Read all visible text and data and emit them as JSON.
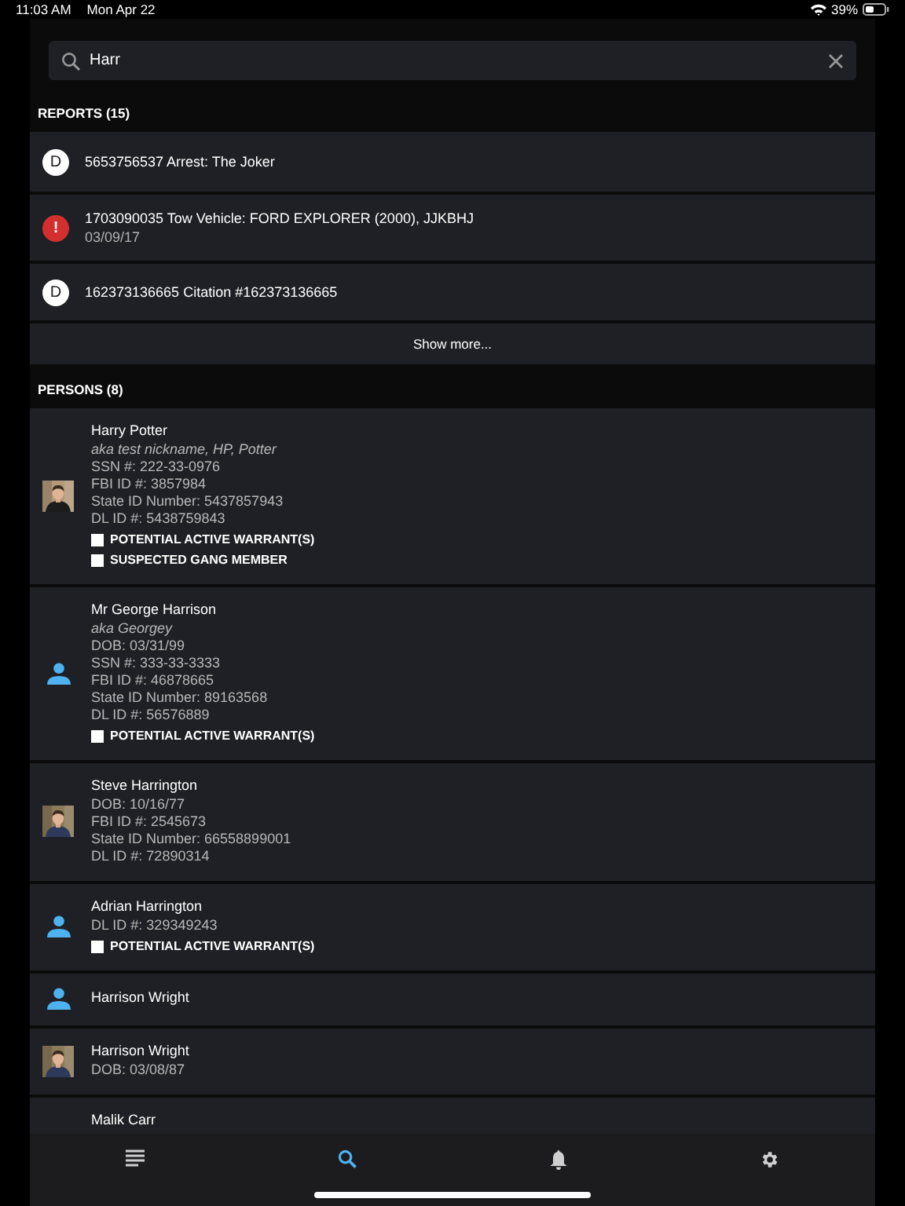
{
  "status_bar": {
    "time": "11:03 AM",
    "date": "Mon Apr 22",
    "battery": "39%"
  },
  "search": {
    "value": "Harr"
  },
  "reports": {
    "title": "REPORTS (15)",
    "items": [
      {
        "badge": {
          "kind": "letter",
          "text": "D"
        },
        "title": "5653756537 Arrest: The Joker"
      },
      {
        "badge": {
          "kind": "alert",
          "text": "!"
        },
        "title": "1703090035 Tow Vehicle: FORD EXPLORER (2000), JJKBHJ",
        "subtitle": "03/09/17"
      },
      {
        "badge": {
          "kind": "letter",
          "text": "D"
        },
        "title": "162373136665 Citation #162373136665"
      }
    ],
    "show_more": "Show more..."
  },
  "persons": {
    "title": "PERSONS (8)",
    "items": [
      {
        "kind": "picture",
        "name": "Harry Potter",
        "aka": "aka test nickname, HP, Potter",
        "details": [
          "SSN #: 222-33-0976",
          "FBI ID #: 3857984",
          "State ID Number: 5437857943",
          "DL ID #: 5438759843"
        ],
        "flags": [
          "POTENTIAL ACTIVE WARRANT(S)",
          "SUSPECTED GANG MEMBER"
        ]
      },
      {
        "kind": "icon",
        "name": "Mr George Harrison",
        "aka": "aka Georgey",
        "details": [
          "DOB: 03/31/99",
          "SSN #: 333-33-3333",
          "FBI ID #: 46878665",
          "State ID Number: 89163568",
          "DL ID #: 56576889"
        ],
        "flags": [
          "POTENTIAL ACTIVE WARRANT(S)"
        ]
      },
      {
        "kind": "picture",
        "name": "Steve Harrington",
        "details": [
          "DOB: 10/16/77",
          "FBI ID #: 2545673",
          "State ID Number: 66558899001",
          "DL ID #: 72890314"
        ]
      },
      {
        "kind": "icon",
        "name": "Adrian Harrington",
        "details": [
          "DL ID #: 329349243"
        ],
        "flags": [
          "POTENTIAL ACTIVE WARRANT(S)"
        ]
      },
      {
        "kind": "icon",
        "name": "Harrison Wright"
      },
      {
        "kind": "picture",
        "name": "Harrison Wright",
        "details": [
          "DOB: 03/08/87"
        ]
      },
      {
        "name": "Malik Carr"
      }
    ]
  },
  "tabs": [
    {
      "kind": "list",
      "selected": false
    },
    {
      "kind": "search",
      "selected": true
    },
    {
      "kind": "bell",
      "selected": false
    },
    {
      "kind": "gear",
      "selected": false
    }
  ]
}
